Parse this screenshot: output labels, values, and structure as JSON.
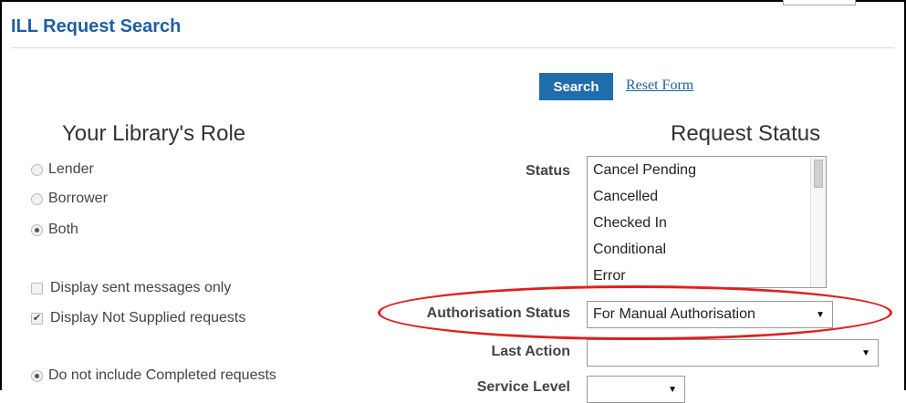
{
  "header": {
    "title": "ILL Request Search"
  },
  "actions": {
    "search_label": "Search",
    "reset_label": "Reset Form"
  },
  "role": {
    "heading": "Your Library's Role",
    "options": [
      {
        "label": "Lender",
        "checked": false
      },
      {
        "label": "Borrower",
        "checked": false
      },
      {
        "label": "Both",
        "checked": true
      }
    ],
    "checkboxes": [
      {
        "label": "Display sent messages only",
        "checked": false
      },
      {
        "label": "Display Not Supplied requests",
        "checked": true
      }
    ],
    "completed": {
      "label": "Do not include Completed requests",
      "checked": true
    }
  },
  "request_status": {
    "heading": "Request Status",
    "status_label": "Status",
    "status_options": [
      "Cancel Pending",
      "Cancelled",
      "Checked In",
      "Conditional",
      "Error"
    ],
    "authorisation_label": "Authorisation Status",
    "authorisation_value": "For Manual Authorisation",
    "last_action_label": "Last Action",
    "last_action_value": "",
    "service_level_label": "Service Level",
    "service_level_value": ""
  },
  "colors": {
    "accent": "#1f6dab",
    "title": "#1f5fa0",
    "highlight": "#e02020"
  },
  "icons": {
    "dropdown": "chevron-down-icon",
    "checked": "check-icon"
  }
}
